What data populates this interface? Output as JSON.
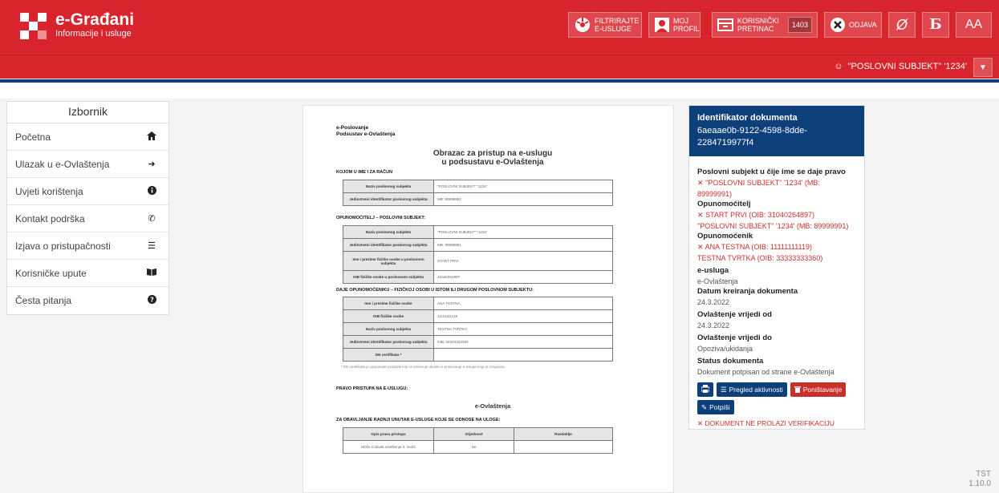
{
  "brand": {
    "title": "e-Građani",
    "subtitle": "Informacije i usluge"
  },
  "toolbar": {
    "filter_label": "FILTRIRAJTE E-USLUGE",
    "profile_label": "MOJ PROFIL",
    "inbox_label": "KORISNIČKI PRETINAC",
    "inbox_count": "1403",
    "logout_label": "ODJAVA",
    "font_label": "AA"
  },
  "user": {
    "name": "\"POSLOVNI SUBJEKT\" '1234'"
  },
  "sidebar": {
    "title": "Izbornik",
    "items": [
      {
        "label": "Početna",
        "icon": "home-icon"
      },
      {
        "label": "Ulazak u e-Ovlaštenja",
        "icon": "sign-in-icon"
      },
      {
        "label": "Uvjeti korištenja",
        "icon": "info-icon"
      },
      {
        "label": "Kontakt podrška",
        "icon": "phone-icon"
      },
      {
        "label": "Izjava o pristupačnosti",
        "icon": "align-icon"
      },
      {
        "label": "Korisničke upute",
        "icon": "book-icon"
      },
      {
        "label": "Česta pitanja",
        "icon": "question-icon"
      }
    ]
  },
  "doc": {
    "line1": "e-Poslovanje",
    "line2": "Podsustav e-Ovlaštenja",
    "title1": "Obrazac za pristup na e-uslugu",
    "title2": "u podsustavu e-Ovlaštenja",
    "sec1": "KOJOM U IME I ZA RAČUN",
    "t1": [
      {
        "k": "Naziv poslovnog subjekta",
        "v": "\"POSLOVNI SUBJEKT\" '1234'"
      },
      {
        "k": "Jedinstveni identifikator poslovnog subjekta",
        "v": "MB: 89999991"
      }
    ],
    "sec2": "OPUNOMOĆITELJ – POSLOVNI SUBJEKT:",
    "t2": [
      {
        "k": "Naziv poslovnog subjekta",
        "v": "\"POSLOVNI SUBJEKT\" '1234'"
      },
      {
        "k": "Jedinstveni identifikator poslovnog subjekta",
        "v": "MB: 89999991"
      },
      {
        "k": "Ime i prezime fizičke osobe u poslovnom subjektu",
        "v": "START PRVI"
      },
      {
        "k": "OIB fizičke osobe u poslovnom subjektu",
        "v": "31040264897"
      }
    ],
    "sec3": "DAJE OPUNOMOĆENIKU – FIZIČKOJ OSOBI U ISTOM ILI DRUGOM POSLOVNOM SUBJEKTU:",
    "t3": [
      {
        "k": "Ime i prezime fizičke osobe",
        "v": "ANA TESTNA"
      },
      {
        "k": "OIB fizičke osobe",
        "v": "11111111119"
      },
      {
        "k": "Naziv poslovnog subjekta",
        "v": "TESTNA TVRTKA"
      },
      {
        "k": "Jedinstveni identifikator poslovnog subjekta",
        "v": "OIB: 33333333360"
      },
      {
        "k": "DN certifikata *",
        "v": ""
      }
    ],
    "footnote": "* DN certifikata je opcionalan podatak koji se prikazuje ukoliko e-poslovanje e-usluge koja je izlogirana",
    "sec4": "PRAVO PRISTUPA NA E-USLUGU:",
    "service": "e-Ovlaštenja",
    "sec5": "ZA OBAVLJANJE RADNJI UNUTAR E-USLUGE KOJE SE ODNOSE NA ULOGE:",
    "t4_head": [
      "Opis prava pristupa",
      "Vrijednost",
      "Razdoblje"
    ],
    "t4_row": [
      "Može li davati ovlaštenja 3. osobi",
      "Ne",
      ""
    ]
  },
  "info": {
    "head_label": "Identifikator dokumenta",
    "head_value": "6aeaae0b-9122-4598-8dde-2284719977f4",
    "subject_label": "Poslovni subjekt u čije ime se daje pravo",
    "subject_value": "\"POSLOVNI SUBJEKT\" '1234' (MB: 89999991)",
    "grantor_label": "Opunomoćitelj",
    "grantor_value1": "START PRVI (OIB: 31040264897)",
    "grantor_value2": "\"POSLOVNI SUBJEKT\" '1234' (MB: 89999991)",
    "grantee_label": "Opunomoćenik",
    "grantee_value1": "ANA TESTNA (OIB: 11111111119)",
    "grantee_value2": "TESTNA TVRTKA (OIB: 33333333360)",
    "service_label": "e-usluga",
    "service_value": "e-Ovlaštenja",
    "created_label": "Datum kreiranja dokumenta",
    "created_value": "24.3.2022",
    "valid_from_label": "Ovlaštenje vrijedi od",
    "valid_from_value": "24.3.2022",
    "valid_to_label": "Ovlaštenje vrijedi do",
    "valid_to_value": "Opoziva/ukidanja",
    "status_label": "Status dokumenta",
    "status_value": "Dokument potpisan od strane e-Ovlaštenja",
    "btn_activity": "Pregled aktivnosti",
    "btn_cancel": "Poništavanje",
    "btn_sign": "Potpiši",
    "verification": "DOKUMENT NE PROLAZI VERIFIKACIJU"
  },
  "version": {
    "env": "TST",
    "number": "1.10.0"
  },
  "colors": {
    "brand_red": "#d8242c",
    "brand_blue": "#0d3f7a",
    "error_red": "#c9302c"
  }
}
